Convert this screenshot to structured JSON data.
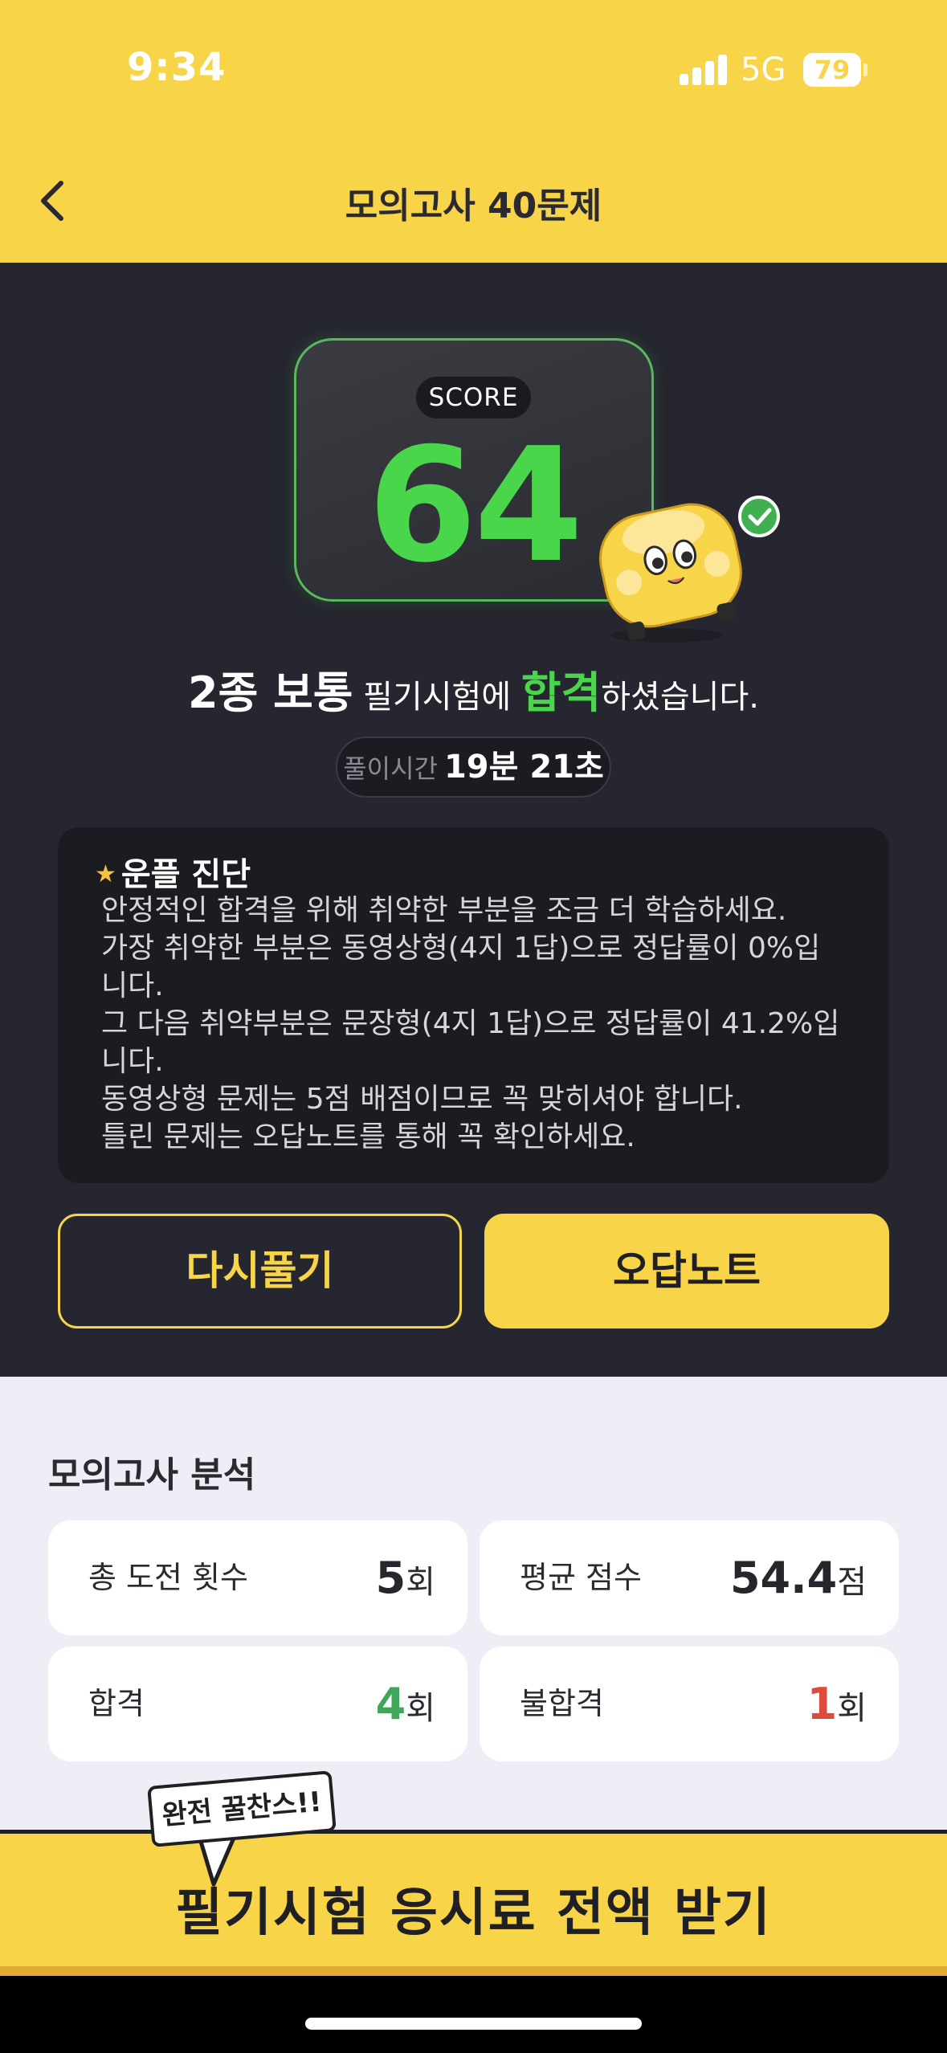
{
  "status_bar": {
    "time": "9:34",
    "network": "5G",
    "battery": "79"
  },
  "header": {
    "title": "모의고사 40문제",
    "back_icon": "chevron-left-icon"
  },
  "score": {
    "label": "SCORE",
    "value": "64",
    "mascot": "yellow-car-mascot-with-check-icon"
  },
  "result": {
    "license": "2종 보통",
    "mid": " 필기시험에 ",
    "status": "합격",
    "suffix": "하셨습니다."
  },
  "solve_time": {
    "label": "풀이시간",
    "value": "19분 21초"
  },
  "diagnosis": {
    "star_icon": "star-icon",
    "title": "운플 진단",
    "lines": [
      "안정적인 합격을 위해 취약한 부분을 조금 더 학습하세요.",
      "가장 취약한 부분은 동영상형(4지 1답)으로 정답률이 0%입니다.",
      "그 다음 취약부분은 문장형(4지 1답)으로 정답률이 41.2%입니다.",
      "동영상형 문제는 5점 배점이므로 꼭 맞히셔야 합니다.",
      "틀린 문제는 오답노트를 통해 꼭 확인하세요."
    ]
  },
  "actions": {
    "retry": "다시풀기",
    "wrong_notes": "오답노트"
  },
  "analysis": {
    "title": "모의고사 분석",
    "stats": [
      {
        "label": "총 도전 횟수",
        "value": "5",
        "unit": "회"
      },
      {
        "label": "평균 점수",
        "value": "54.4",
        "unit": "점"
      },
      {
        "label": "합격",
        "value": "4",
        "unit": "회"
      },
      {
        "label": "불합격",
        "value": "1",
        "unit": "회"
      }
    ]
  },
  "promo": {
    "badge": "완전 꿀찬스!!",
    "text": "필기시험 응시료 전액 받기"
  },
  "colors": {
    "brand_yellow": "#f8d448",
    "dark_bg": "#25262f",
    "pass_green": "#4ad64a",
    "stat_green": "#3fa65a",
    "stat_red": "#e04a3c"
  }
}
